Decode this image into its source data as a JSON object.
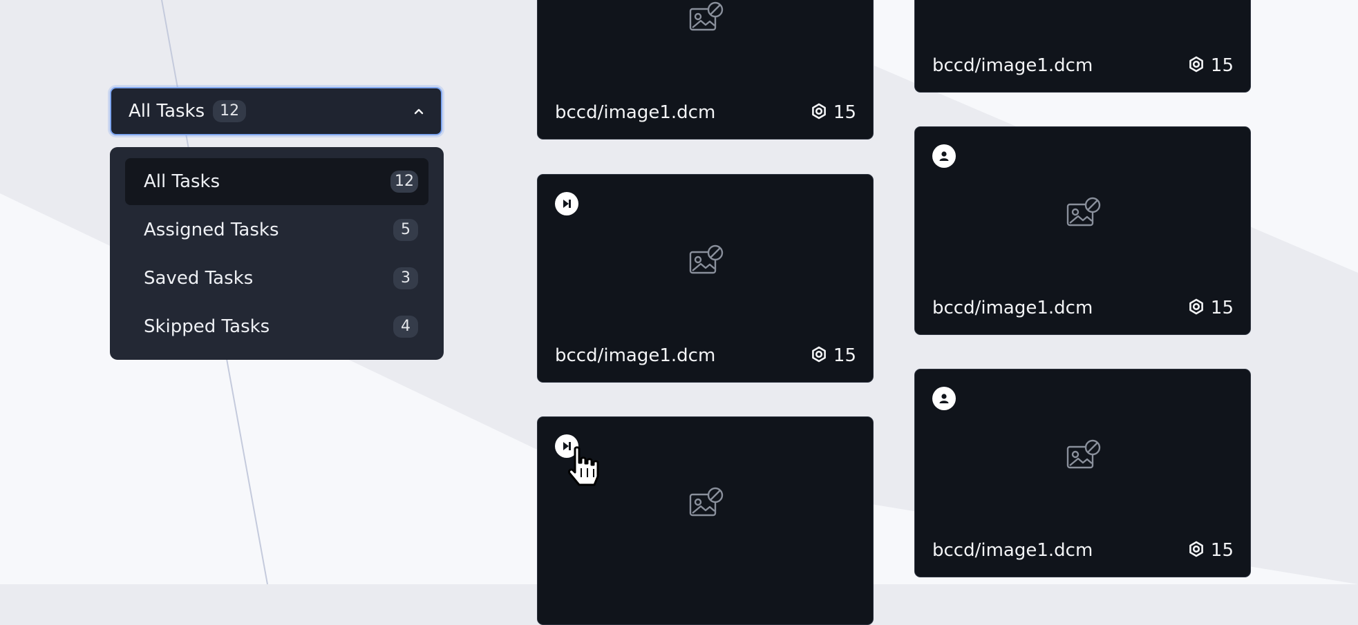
{
  "dropdown": {
    "label": "All Tasks",
    "count": "12",
    "expanded": true,
    "toggle_icon": "chevron-up-icon",
    "options": [
      {
        "label": "All Tasks",
        "count": "12",
        "selected": true
      },
      {
        "label": "Assigned Tasks",
        "count": "5",
        "selected": false
      },
      {
        "label": "Saved Tasks",
        "count": "3",
        "selected": false
      },
      {
        "label": "Skipped Tasks",
        "count": "4",
        "selected": false
      }
    ]
  },
  "cards": [
    {
      "name": "bccd/image1.dcm",
      "score": "15",
      "badge": "none",
      "thumbnail": "image-unavailable-icon"
    },
    {
      "name": "bccd/image1.dcm",
      "score": "15",
      "badge": "skip-icon",
      "thumbnail": "image-unavailable-icon"
    },
    {
      "name": "",
      "score": "",
      "badge": "skip-icon",
      "thumbnail": "image-unavailable-icon"
    },
    {
      "name": "bccd/image1.dcm",
      "score": "15",
      "badge": "none",
      "thumbnail": "image-unavailable-icon"
    },
    {
      "name": "bccd/image1.dcm",
      "score": "15",
      "badge": "user-icon",
      "thumbnail": "image-unavailable-icon"
    },
    {
      "name": "bccd/image1.dcm",
      "score": "15",
      "badge": "user-icon",
      "thumbnail": "image-unavailable-icon"
    }
  ],
  "score_icon": "settings-ring-icon",
  "colors": {
    "page_background": "#eaebf0",
    "card_background": "#10141b",
    "menu_background": "#232834",
    "focus_ring": "#7fa6f0"
  }
}
